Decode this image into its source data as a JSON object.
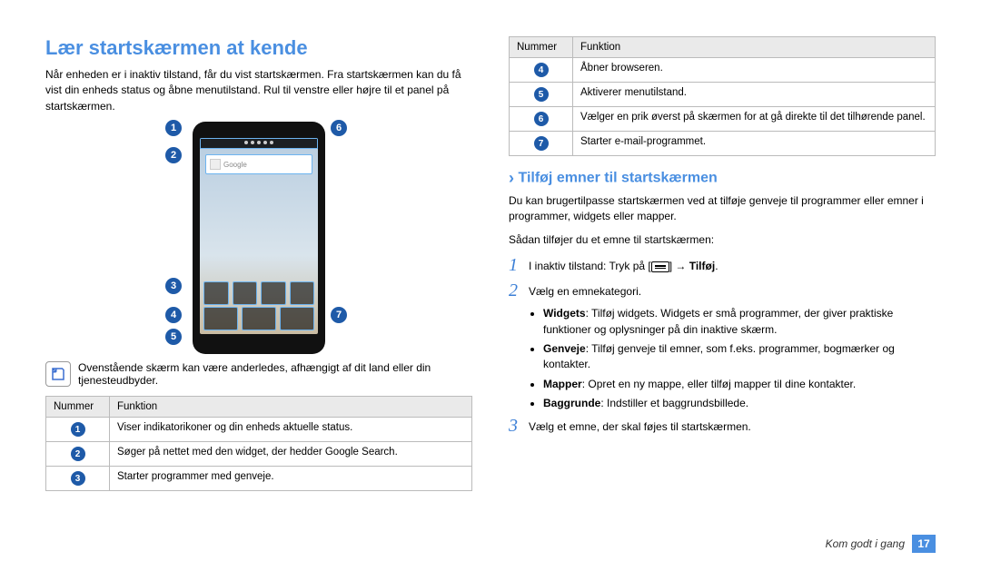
{
  "heading": "Lær startskærmen at kende",
  "intro": "Når enheden er i inaktiv tilstand, får du vist startskærmen. Fra startskærmen kan du få vist din enheds status og åbne menutilstand. Rul til venstre eller højre til et panel på startskærmen.",
  "note": "Ovenstående skærm kan være anderledes, afhængigt af dit land eller din tjenesteudbyder.",
  "search_placeholder": "Google",
  "table_headers": {
    "number": "Nummer",
    "function": "Funktion"
  },
  "table_left": [
    {
      "n": "1",
      "text": "Viser indikatorikoner og din enheds aktuelle status."
    },
    {
      "n": "2",
      "text": "Søger på nettet med den widget, der hedder Google Search."
    },
    {
      "n": "3",
      "text": "Starter programmer med genveje."
    }
  ],
  "table_right": [
    {
      "n": "4",
      "text": "Åbner browseren."
    },
    {
      "n": "5",
      "text": "Aktiverer menutilstand."
    },
    {
      "n": "6",
      "text": "Vælger en prik øverst på skærmen for at gå direkte til det tilhørende panel."
    },
    {
      "n": "7",
      "text": "Starter e-mail-programmet."
    }
  ],
  "subheading": "Tilføj emner til startskærmen",
  "sub_intro": "Du kan brugertilpasse startskærmen ved at tilføje genveje til programmer eller emner i programmer, widgets eller mapper.",
  "sub_lead": "Sådan tilføjer du et emne til startskærmen:",
  "steps": {
    "s1_a": "I inaktiv tilstand: Tryk på [",
    "s1_b": "] → ",
    "s1_bold": "Tilføj",
    "s2": "Vælg en emnekategori.",
    "s3": "Vælg et emne, der skal føjes til startskærmen."
  },
  "bullets": [
    {
      "bold": "Widgets",
      "rest": ": Tilføj widgets. Widgets er små programmer, der giver praktiske funktioner og oplysninger på din inaktive skærm."
    },
    {
      "bold": "Genveje",
      "rest": ": Tilføj genveje til emner, som f.eks. programmer, bogmærker og kontakter."
    },
    {
      "bold": "Mapper",
      "rest": ": Opret en ny mappe, eller tilføj mapper til dine kontakter."
    },
    {
      "bold": "Baggrunde",
      "rest": ": Indstiller et baggrundsbillede."
    }
  ],
  "footer_text": "Kom godt i gang",
  "page_number": "17"
}
